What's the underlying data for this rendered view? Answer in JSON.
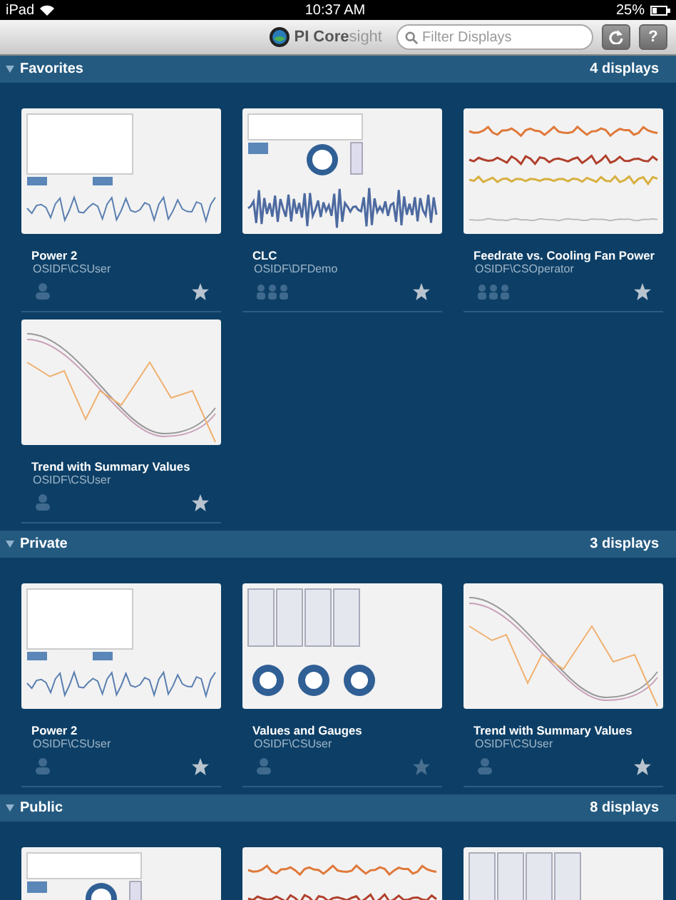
{
  "status_bar": {
    "device": "iPad",
    "time": "10:37 AM",
    "battery": "25%"
  },
  "toolbar": {
    "logo_a": "PI Core",
    "logo_b": "sight",
    "search": {
      "placeholder": "Filter Displays"
    },
    "buttons": [
      "?"
    ]
  },
  "sections": [
    {
      "title": "Favorites",
      "count": "4 displays",
      "expanded": true,
      "cards": [
        {
          "title": "Power 2",
          "owner": "OSIDF\\CSUser",
          "owner_icon": {
            "kind": "user"
          },
          "favorite": true,
          "thumbnail": {
            "kind": "table"
          }
        },
        {
          "title": "CLC",
          "owner": "OSIDF\\DFDemo",
          "owner_icon": {
            "kind": "group"
          },
          "favorite": true,
          "thumbnail": {
            "kind": "dashboard"
          }
        },
        {
          "title": "Feedrate vs. Cooling Fan Power",
          "owner": "OSIDF\\CSOperator",
          "owner_icon": {
            "kind": "group"
          },
          "favorite": true,
          "thumbnail": {
            "kind": "trend"
          }
        },
        {
          "title": "Trend with Summary Values",
          "owner": "OSIDF\\CSUser",
          "owner_icon": {
            "kind": "user"
          },
          "favorite": true,
          "thumbnail": {
            "kind": "summary"
          }
        }
      ]
    },
    {
      "title": "Private",
      "count": "3 displays",
      "expanded": true,
      "cards": [
        {
          "title": "Power 2",
          "owner": "OSIDF\\CSUser",
          "owner_icon": {
            "kind": "user"
          },
          "favorite": true,
          "thumbnail": {
            "kind": "table"
          }
        },
        {
          "title": "Values and Gauges",
          "owner": "OSIDF\\CSUser",
          "owner_icon": {
            "kind": "user"
          },
          "favorite": false,
          "thumbnail": {
            "kind": "gauges"
          }
        },
        {
          "title": "Trend with Summary Values",
          "owner": "OSIDF\\CSUser",
          "owner_icon": {
            "kind": "user"
          },
          "favorite": true,
          "thumbnail": {
            "kind": "summary"
          }
        }
      ]
    },
    {
      "title": "Public",
      "count": "8 displays",
      "expanded": true,
      "cards": [
        {
          "thumbnail": {
            "kind": "dashboard"
          }
        },
        {
          "thumbnail": {
            "kind": "trend"
          }
        },
        {
          "thumbnail": {
            "kind": "gauges"
          }
        }
      ]
    }
  ]
}
